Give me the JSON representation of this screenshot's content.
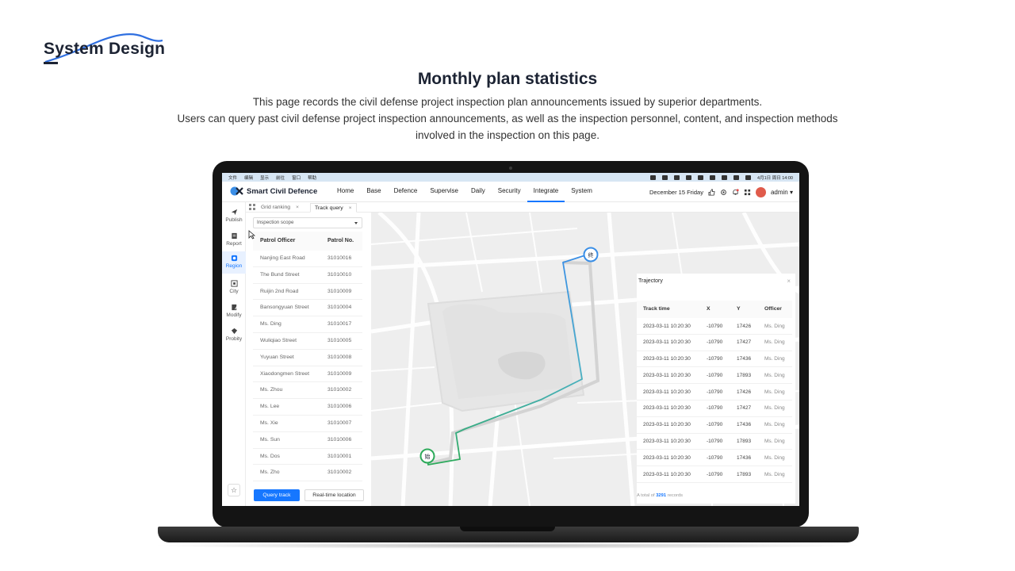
{
  "brand": {
    "name": "System Design"
  },
  "heading": {
    "title": "Monthly plan statistics",
    "lines": [
      "This page records the civil defense project inspection plan announcements issued by superior departments.",
      "Users can query past civil defense project inspection announcements, as well as the inspection personnel, content, and inspection methods",
      "involved in the inspection on this page."
    ]
  },
  "menubar": {
    "left": [
      "文件",
      "编辑",
      "显示",
      "前往",
      "窗口",
      "帮助"
    ],
    "clock": "4月1日 周日  14:00"
  },
  "app": {
    "name": "Smart Civil Defence",
    "nav": [
      "Home",
      "Base",
      "Defence",
      "Supervise",
      "Daily",
      "Security",
      "Integrate",
      "System"
    ],
    "active_nav": "Integrate",
    "date": "December 15  Friday",
    "user": "admin",
    "accent": "#1677ff"
  },
  "sidebar": {
    "items": [
      {
        "label": "Publish",
        "icon": "send-icon"
      },
      {
        "label": "Report",
        "icon": "report-icon"
      },
      {
        "label": "Region",
        "icon": "region-icon"
      },
      {
        "label": "City",
        "icon": "city-icon"
      },
      {
        "label": "Modify",
        "icon": "edit-icon"
      },
      {
        "label": "Probity",
        "icon": "probity-icon"
      }
    ],
    "active": "Region"
  },
  "tabs": [
    {
      "label": "Grid ranking"
    },
    {
      "label": "Track query"
    }
  ],
  "panel": {
    "scope_placeholder": "Inspection scope",
    "columns": [
      "Patrol Officer",
      "Patrol No."
    ],
    "rows": [
      [
        "Nanjing East Road",
        "31010016"
      ],
      [
        "The Bund Street",
        "31010010"
      ],
      [
        "Ruijin 2nd Road",
        "31010009"
      ],
      [
        "Bansongyuan Street",
        "31010004"
      ],
      [
        "Ms. Ding",
        "31010017"
      ],
      [
        "Wuliqiao Street",
        "31010005"
      ],
      [
        "Yuyuan Street",
        "31010008"
      ],
      [
        "Xiaodongmen Street",
        "31010009"
      ],
      [
        "Ms. Zhou",
        "31010002"
      ],
      [
        "Ms. Lee",
        "31010006"
      ],
      [
        "Ms. Xie",
        "31010007"
      ],
      [
        "Ms. Sun",
        "31010006"
      ],
      [
        "Ms. Dos",
        "31010001"
      ],
      [
        "Ms. Zho",
        "31010002"
      ]
    ],
    "query_btn": "Query track",
    "realtime_btn": "Real-time location"
  },
  "map": {
    "start_label": "始",
    "end_label": "终",
    "start_color": "#2daa5a",
    "end_color": "#3a8ee6"
  },
  "trajectory": {
    "title": "Trajectory",
    "columns": [
      "Track time",
      "X",
      "Y",
      "Officer"
    ],
    "rows": [
      [
        "2023-03-11 10:20:30",
        "-10790",
        "17426",
        "Ms. Ding"
      ],
      [
        "2023-03-11 10:20:30",
        "-10790",
        "17427",
        "Ms. Ding"
      ],
      [
        "2023-03-11 10:20:30",
        "-10790",
        "17436",
        "Ms. Ding"
      ],
      [
        "2023-03-11 10:20:30",
        "-10790",
        "17893",
        "Ms. Ding"
      ],
      [
        "2023-03-11 10:20:30",
        "-10790",
        "17426",
        "Ms. Ding"
      ],
      [
        "2023-03-11 10:20:30",
        "-10790",
        "17427",
        "Ms. Ding"
      ],
      [
        "2023-03-11 10:20:30",
        "-10790",
        "17436",
        "Ms. Ding"
      ],
      [
        "2023-03-11 10:20:30",
        "-10790",
        "17893",
        "Ms. Ding"
      ],
      [
        "2023-03-11 10:20:30",
        "-10790",
        "17436",
        "Ms. Ding"
      ],
      [
        "2023-03-11 10:20:30",
        "-10790",
        "17893",
        "Ms. Ding"
      ]
    ],
    "footer_prefix": "A total of",
    "total": "3291",
    "footer_suffix": "records"
  }
}
